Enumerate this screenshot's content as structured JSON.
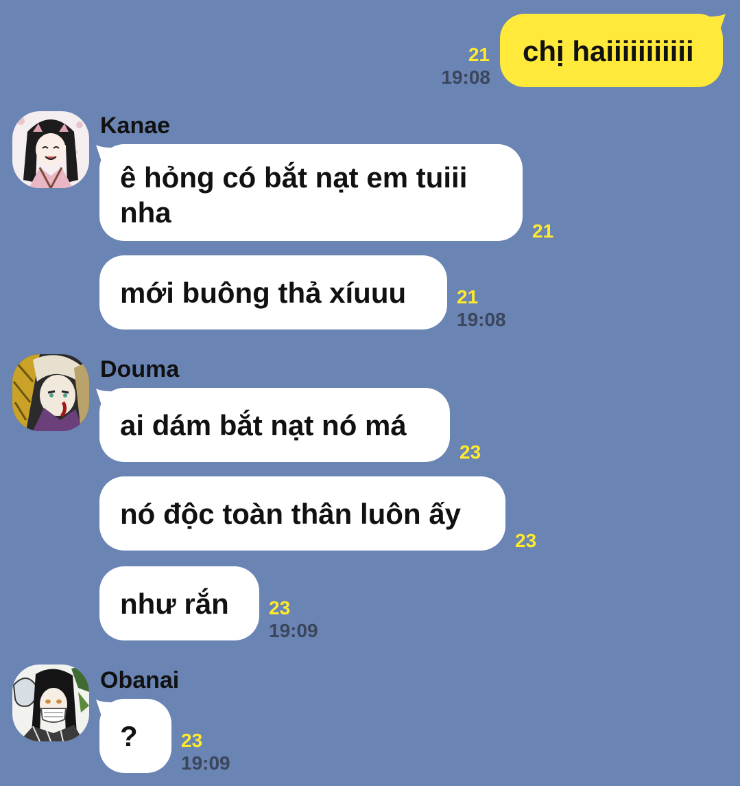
{
  "chat": {
    "outgoing": [
      {
        "text": "chị haiiiiiiiiiii",
        "read_count": "21",
        "time": "19:08"
      }
    ],
    "groups": [
      {
        "sender": "Kanae",
        "avatar_icon": "kanae-avatar-icon",
        "messages": [
          {
            "text": "ê hỏng có bắt nạt em tuiii nha",
            "read_count": "21"
          },
          {
            "text": "mới buông thả xíuuu",
            "read_count": "21",
            "time": "19:08"
          }
        ]
      },
      {
        "sender": "Douma",
        "avatar_icon": "douma-avatar-icon",
        "messages": [
          {
            "text": "ai dám bắt nạt nó má",
            "read_count": "23"
          },
          {
            "text": "nó độc toàn thân luôn ấy",
            "read_count": "23"
          },
          {
            "text": "như rắn",
            "read_count": "23",
            "time": "19:09"
          }
        ]
      },
      {
        "sender": "Obanai",
        "avatar_icon": "obanai-avatar-icon",
        "messages": [
          {
            "text": "?",
            "read_count": "23",
            "time": "19:09"
          }
        ]
      }
    ]
  },
  "colors": {
    "background": "#6a84b4",
    "incoming_bubble": "#ffffff",
    "outgoing_bubble": "#ffe93b",
    "read_count": "#ffea2e",
    "timestamp": "#3b465c"
  }
}
